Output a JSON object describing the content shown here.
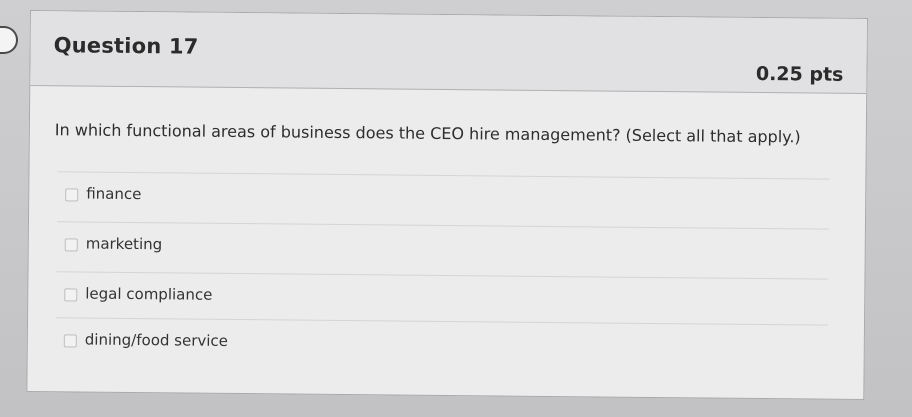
{
  "question": {
    "title": "Question 17",
    "points": "0.25 pts",
    "prompt": "In which functional areas of business does the CEO hire management? (Select all that apply.)"
  },
  "answers": [
    {
      "label": "finance",
      "checked": false
    },
    {
      "label": "marketing",
      "checked": false
    },
    {
      "label": "legal compliance",
      "checked": false
    },
    {
      "label": "dining/food service",
      "checked": false
    }
  ],
  "colors": {
    "header_background": "#e1e1e3",
    "card_background": "#ececed",
    "text": "#2b2b2b"
  }
}
